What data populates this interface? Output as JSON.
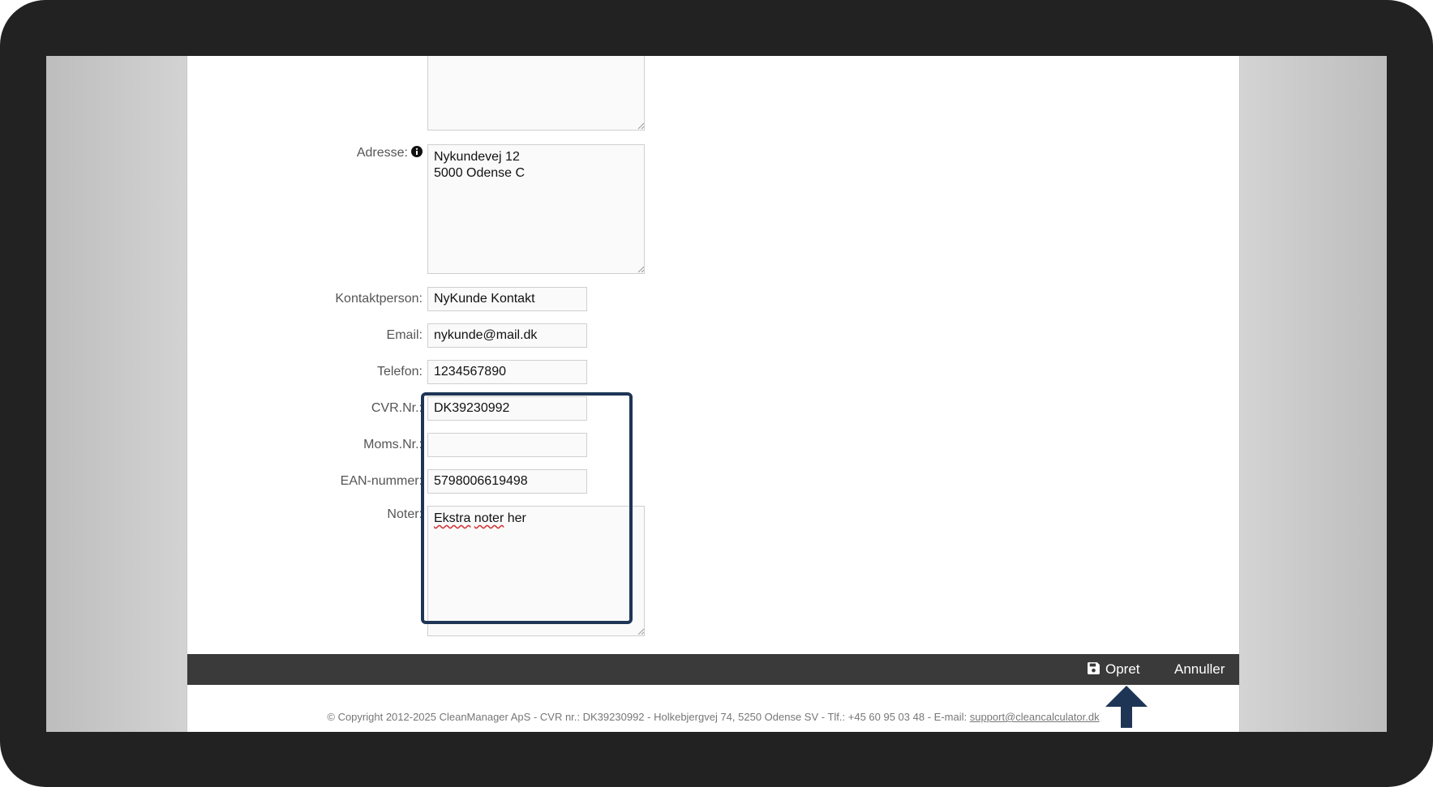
{
  "form": {
    "address": {
      "label": "Adresse:",
      "value": "Nykundevej 12\n5000 Odense C"
    },
    "contact": {
      "label": "Kontaktperson:",
      "value": "NyKunde Kontakt"
    },
    "email": {
      "label": "Email:",
      "value": "nykunde@mail.dk"
    },
    "phone": {
      "label": "Telefon:",
      "value": "1234567890"
    },
    "cvr": {
      "label": "CVR.Nr.:",
      "value": "DK39230992"
    },
    "vat": {
      "label": "Moms.Nr.:",
      "value": ""
    },
    "ean": {
      "label": "EAN-nummer:",
      "value": "5798006619498"
    },
    "notes": {
      "label": "Noter:",
      "value_word1": "Ekstra",
      "value_word2": "noter",
      "value_word3": "her"
    }
  },
  "actions": {
    "create_label": "Opret",
    "cancel_label": "Annuller"
  },
  "footer": {
    "text": "© Copyright 2012-2025 CleanManager ApS - CVR nr.: DK39230992 - Holkebjergvej 74, 5250 Odense SV - Tlf.: +45 60 95 03 48 - E-mail:",
    "email_link": "support@cleancalculator.dk"
  },
  "colors": {
    "highlight": "#1e3556",
    "arrow": "#1e3556",
    "action_bar": "#3a3a3a"
  },
  "icons": [
    "info-icon",
    "save-icon",
    "arrow-up-icon",
    "resize-grip-icon"
  ]
}
